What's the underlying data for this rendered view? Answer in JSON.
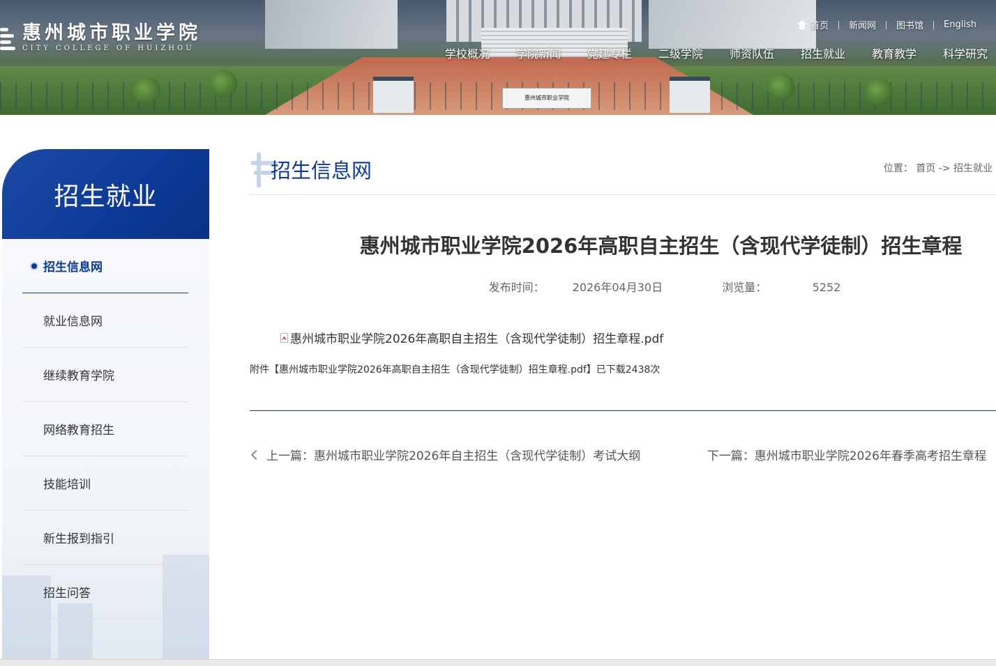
{
  "header": {
    "logo_cn": "惠州城市职业学院",
    "logo_en": "CITY COLLEGE OF HUIZHOU",
    "gate_sign": "惠州城市职业学院",
    "top_links": [
      "首页",
      "新闻网",
      "图书馆",
      "English"
    ],
    "nav": [
      "学校概况",
      "学院新闻",
      "党建专栏",
      "二级学院",
      "师资队伍",
      "招生就业",
      "教育教学",
      "科学研究"
    ]
  },
  "sidebar": {
    "title": "招生就业",
    "items": [
      {
        "label": "招生信息网",
        "active": true
      },
      {
        "label": "就业信息网"
      },
      {
        "label": "继续教育学院"
      },
      {
        "label": "网络教育招生"
      },
      {
        "label": "技能培训"
      },
      {
        "label": "新生报到指引"
      },
      {
        "label": "招生问答"
      }
    ]
  },
  "section": {
    "title": "招生信息网",
    "breadcrumb_label": "位置：",
    "breadcrumb_home": "首页",
    "breadcrumb_sep": "->",
    "breadcrumb_current": "招生就业"
  },
  "article": {
    "title": "惠州城市职业学院2026年高职自主招生（含现代学徒制）招生章程",
    "publish_label": "发布时间：",
    "publish_date": "2026年04月30日",
    "views_label": "浏览量：",
    "views": "5252",
    "attachment_name": "惠州城市职业学院2026年高职自主招生（含现代学徒制）招生章程.pdf",
    "attachment_note": "附件【惠州城市职业学院2026年高职自主招生（含现代学徒制）招生章程.pdf】已下载2438次",
    "prev": "上一篇：惠州城市职业学院2026年自主招生（含现代学徒制）考试大纲",
    "next": "下一篇：惠州城市职业学院2026年春季高考招生章程"
  },
  "colors": {
    "primary": "#0d3a96",
    "rule": "#1f3f66",
    "text": "#333333"
  }
}
